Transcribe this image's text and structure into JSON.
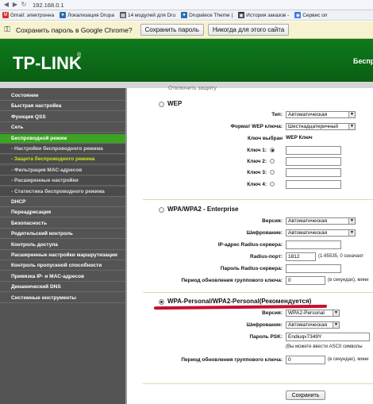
{
  "browser": {
    "url": "192.168.0.1",
    "bookmarks": [
      {
        "label": "Gmail: электронна",
        "color": "#d93025",
        "glyph": "M"
      },
      {
        "label": "Локализация Drupa",
        "color": "#2a6db4",
        "glyph": "●"
      },
      {
        "label": "14 модулей для Dru",
        "color": "#555555",
        "glyph": "▦"
      },
      {
        "label": "Drupalece Theme |",
        "color": "#2a6db4",
        "glyph": "●"
      },
      {
        "label": "История заказов -",
        "color": "#333333",
        "glyph": "▣"
      },
      {
        "label": "Сервис оп",
        "color": "#3a7bd5",
        "glyph": "◉"
      }
    ],
    "infobar": {
      "text": "Сохранить пароль в Google Chrome?",
      "save_label": "Сохранить пароль",
      "never_label": "Никогда для этого сайта"
    }
  },
  "router": {
    "logo": "TP-LINK",
    "logo_mark": "®",
    "header_right": "Беспр"
  },
  "sidebar": {
    "items": [
      {
        "label": "Состояние",
        "type": "main"
      },
      {
        "label": "Быстрая настройка",
        "type": "main"
      },
      {
        "label": "Функция QSS",
        "type": "main"
      },
      {
        "label": "Сеть",
        "type": "main"
      },
      {
        "label": "Беспроводной режим",
        "type": "active"
      },
      {
        "label": "- Настройки беспроводного режима",
        "type": "sub"
      },
      {
        "label": "- Защита беспроводного режима",
        "type": "current"
      },
      {
        "label": "- Фильтрация MAC-адресов",
        "type": "sub"
      },
      {
        "label": "- Расширенные настройки",
        "type": "sub"
      },
      {
        "label": "- Статистика беспроводного режима",
        "type": "sub"
      },
      {
        "label": "DHCP",
        "type": "main"
      },
      {
        "label": "Переадресация",
        "type": "main"
      },
      {
        "label": "Безопасность",
        "type": "main"
      },
      {
        "label": "Родительский контроль",
        "type": "main"
      },
      {
        "label": "Контроль доступа",
        "type": "main"
      },
      {
        "label": "Расширенные настройки маршрутизации",
        "type": "main"
      },
      {
        "label": "Контроль пропускной способности",
        "type": "main"
      },
      {
        "label": "Привязка IP- и MAC-адресов",
        "type": "main"
      },
      {
        "label": "Динамический DNS",
        "type": "main"
      },
      {
        "label": "Системные инструменты",
        "type": "main"
      }
    ]
  },
  "main": {
    "cut_top": "Отключить защиту",
    "wep": {
      "title": "WEP",
      "type_label": "Тип:",
      "type_value": "Автоматическая",
      "format_label": "Формат WEP ключа:",
      "format_value": "Шестнадцатеричный",
      "key_selected_label": "Ключ выбран",
      "wep_key_label": "WEP Ключ",
      "keys": [
        "Ключ 1:",
        "Ключ 2:",
        "Ключ 3:",
        "Ключ 4:"
      ]
    },
    "enterprise": {
      "title": "WPA/WPA2 - Enterprise",
      "version_label": "Версия:",
      "version_value": "Автоматическая",
      "encryption_label": "Шифрование:",
      "encryption_value": "Автоматическая",
      "radius_ip_label": "IP-адрес Radius-сервера:",
      "radius_port_label": "Radius-порт:",
      "radius_port_value": "1812",
      "radius_port_hint": "(1-65535, 0 означает",
      "radius_pwd_label": "Пароль Radius-сервера:",
      "group_period_label": "Период обновления группового ключа:",
      "group_period_value": "0",
      "group_period_hint": "(в секундах), мини"
    },
    "personal": {
      "title": "WPA-Personal/WPA2-Personal(Рекомендуется)",
      "version_label": "Версия:",
      "version_value": "WPA2-Personal",
      "encryption_label": "Шифрование:",
      "encryption_value": "Автоматическая",
      "psk_label": "Пароль PSK:",
      "psk_value": "Endiuqv7349Y",
      "psk_hint": "(Вы можете ввести ASCII символы",
      "group_period_label": "Период обновления группового ключа:",
      "group_period_value": "0",
      "group_period_hint": "(в секундах), мини"
    },
    "save_label": "Сохранить"
  }
}
